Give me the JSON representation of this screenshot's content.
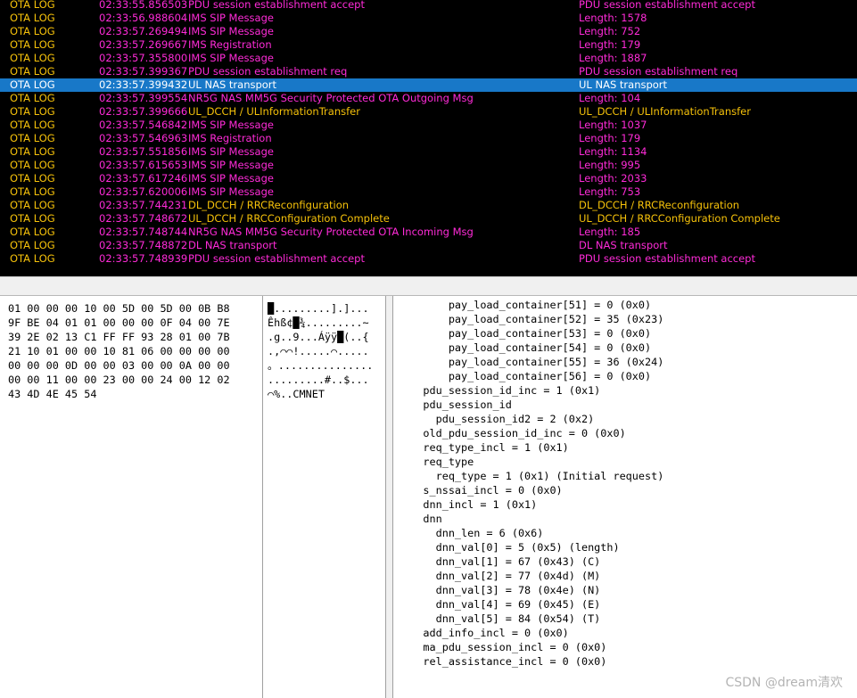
{
  "log_table": {
    "colors": {
      "ota": "#f5c10a",
      "pdu": "#ff2bd8",
      "ims": "#ff2bd8",
      "time": "#ff2bd8",
      "selected_bg": "#1878c8"
    },
    "rows": [
      {
        "type": "OTA LOG",
        "time": "02:33:55.856503",
        "msg": "PDU session establishment accept",
        "info": "PDU session establishment accept",
        "type_color": "ota",
        "msg_color": "pdu"
      },
      {
        "type": "OTA LOG",
        "time": "02:33:56.988604",
        "msg": "IMS SIP Message",
        "info": "Length: 1578",
        "type_color": "ota",
        "msg_color": "ims"
      },
      {
        "type": "OTA LOG",
        "time": "02:33:57.269494",
        "msg": "IMS SIP Message",
        "info": "Length: 752",
        "type_color": "ota",
        "msg_color": "ims"
      },
      {
        "type": "OTA LOG",
        "time": "02:33:57.269667",
        "msg": "IMS Registration",
        "info": "Length: 179",
        "type_color": "ota",
        "msg_color": "ims"
      },
      {
        "type": "OTA LOG",
        "time": "02:33:57.355800",
        "msg": "IMS SIP Message",
        "info": "Length: 1887",
        "type_color": "ota",
        "msg_color": "ims"
      },
      {
        "type": "OTA LOG",
        "time": "02:33:57.399367",
        "msg": "PDU session establishment req",
        "info": "PDU session establishment req",
        "type_color": "ota",
        "msg_color": "pdu"
      },
      {
        "type": "OTA LOG",
        "time": "02:33:57.399432",
        "msg": "UL NAS transport",
        "info": "UL NAS transport",
        "type_color": "ota",
        "msg_color": "pdu",
        "selected": true
      },
      {
        "type": "OTA LOG",
        "time": "02:33:57.399554",
        "msg": "NR5G NAS MM5G Security Protected OTA Outgoing Msg",
        "info": "Length: 104",
        "type_color": "ota",
        "msg_color": "pdu"
      },
      {
        "type": "OTA LOG",
        "time": "02:33:57.399666",
        "msg": "UL_DCCH / ULInformationTransfer",
        "info": "UL_DCCH / ULInformationTransfer",
        "type_color": "ota",
        "msg_color": "ota"
      },
      {
        "type": "OTA LOG",
        "time": "02:33:57.546842",
        "msg": "IMS SIP Message",
        "info": "Length: 1037",
        "type_color": "ota",
        "msg_color": "ims"
      },
      {
        "type": "OTA LOG",
        "time": "02:33:57.546963",
        "msg": "IMS Registration",
        "info": "Length: 179",
        "type_color": "ota",
        "msg_color": "ims"
      },
      {
        "type": "OTA LOG",
        "time": "02:33:57.551856",
        "msg": "IMS SIP Message",
        "info": "Length: 1134",
        "type_color": "ota",
        "msg_color": "ims"
      },
      {
        "type": "OTA LOG",
        "time": "02:33:57.615653",
        "msg": "IMS SIP Message",
        "info": "Length: 995",
        "type_color": "ota",
        "msg_color": "ims"
      },
      {
        "type": "OTA LOG",
        "time": "02:33:57.617246",
        "msg": "IMS SIP Message",
        "info": "Length: 2033",
        "type_color": "ota",
        "msg_color": "ims"
      },
      {
        "type": "OTA LOG",
        "time": "02:33:57.620006",
        "msg": "IMS SIP Message",
        "info": "Length: 753",
        "type_color": "ota",
        "msg_color": "ims"
      },
      {
        "type": "OTA LOG",
        "time": "02:33:57.744231",
        "msg": "DL_DCCH / RRCReconfiguration",
        "info": "DL_DCCH / RRCReconfiguration",
        "type_color": "ota",
        "msg_color": "ota"
      },
      {
        "type": "OTA LOG",
        "time": "02:33:57.748672",
        "msg": "UL_DCCH / RRCConfiguration Complete",
        "info": "UL_DCCH / RRCConfiguration Complete",
        "type_color": "ota",
        "msg_color": "ota"
      },
      {
        "type": "OTA LOG",
        "time": "02:33:57.748744",
        "msg": "NR5G NAS MM5G Security Protected OTA Incoming Msg",
        "info": "Length: 185",
        "type_color": "ota",
        "msg_color": "pdu"
      },
      {
        "type": "OTA LOG",
        "time": "02:33:57.748872",
        "msg": "DL NAS transport",
        "info": "DL NAS transport",
        "type_color": "ota",
        "msg_color": "pdu"
      },
      {
        "type": "OTA LOG",
        "time": "02:33:57.748939",
        "msg": "PDU session establishment accept",
        "info": "PDU session establishment accept",
        "type_color": "ota",
        "msg_color": "pdu"
      }
    ]
  },
  "hex_view": {
    "lines": [
      "01 00 00 00 10 00 5D 00 5D 00 0B B8",
      "9F BE 04 01 01 00 00 00 0F 04 00 7E",
      "39 2E 02 13 C1 FF FF 93 28 01 00 7B",
      "21 10 01 00 00 10 81 06 00 00 00 00",
      "00 00 00 0D 00 00 03 00 00 0A 00 00",
      "00 00 11 00 00 23 00 00 24 00 12 02",
      "43 4D 4E 45 54"
    ]
  },
  "ascii_view": {
    "lines": [
      "█.........].]...",
      "Êhß¢█¾.........~",
      ".g..9...Áÿÿ█(..{",
      ".,⌒⌒!.....⌒.....",
      "。...............",
      ".........#..$...",
      "⌒%..CMNET"
    ]
  },
  "decode_view": {
    "lines": [
      "        pay_load_container[51] = 0 (0x0)",
      "        pay_load_container[52] = 35 (0x23)",
      "        pay_load_container[53] = 0 (0x0)",
      "        pay_load_container[54] = 0 (0x0)",
      "        pay_load_container[55] = 36 (0x24)",
      "        pay_load_container[56] = 0 (0x0)",
      "    pdu_session_id_inc = 1 (0x1)",
      "    pdu_session_id",
      "      pdu_session_id2 = 2 (0x2)",
      "    old_pdu_session_id_inc = 0 (0x0)",
      "    req_type_incl = 1 (0x1)",
      "    req_type",
      "      req_type = 1 (0x1) (Initial request)",
      "    s_nssai_incl = 0 (0x0)",
      "    dnn_incl = 1 (0x1)",
      "    dnn",
      "      dnn_len = 6 (0x6)",
      "      dnn_val[0] = 5 (0x5) (length)",
      "      dnn_val[1] = 67 (0x43) (C)",
      "      dnn_val[2] = 77 (0x4d) (M)",
      "      dnn_val[3] = 78 (0x4e) (N)",
      "      dnn_val[4] = 69 (0x45) (E)",
      "      dnn_val[5] = 84 (0x54) (T)",
      "    add_info_incl = 0 (0x0)",
      "    ma_pdu_session_incl = 0 (0x0)",
      "    rel_assistance_incl = 0 (0x0)"
    ]
  },
  "watermark": {
    "text": "CSDN @dream清欢"
  }
}
